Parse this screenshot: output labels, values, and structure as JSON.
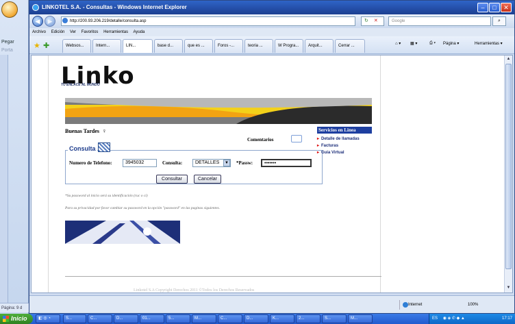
{
  "background_app": {
    "tabs": [
      "Pegar",
      "Porta"
    ],
    "status": "Página: 9 d"
  },
  "window": {
    "title": "LINKOTEL S.A. - Consultas - Windows Internet Explorer",
    "address": "http://200.93.206.219/detalle/consulta.asp",
    "search_placeholder": "Google",
    "menu": [
      "Archivo",
      "Edición",
      "Ver",
      "Favoritos",
      "Herramientas",
      "Ayuda"
    ],
    "tabs": [
      "Websos...",
      "Intern...",
      "LIN...",
      "base d...",
      "que es ...",
      "Foros -...",
      "teoria ...",
      "W Progra...",
      "Arquit...",
      "Cerrar ..."
    ],
    "commands": [
      "Página ▾",
      "Herramientas ▾"
    ],
    "status_zone": "Internet",
    "zoom": "100%"
  },
  "page": {
    "logo_text": "Linko",
    "tagline": "TU ENLACE AL MUNDO",
    "greeting": "Buenas Tardes",
    "comentarios": "Comentarios",
    "consulta": {
      "legend": "Consulta",
      "phone_label": "Numero de Telefono:",
      "phone_value": "3945032",
      "consulta_label": "Consulta:",
      "consulta_value": "DETALLES",
      "pass_label": "*Passw:",
      "pass_value": "•••••••",
      "submit": "Consultar",
      "cancel": "Cancelar"
    },
    "note1": "*Su password al inicio será su identificación (ruc o ci)",
    "note2": "Para su privacidad por favor cambiar su password en la opción \"password\" en las paginas siguientes.",
    "footer": "Linkotel S.A Copyright Derechos 2011 ©Todos los Derechos Reservados",
    "side_menu": {
      "title": "Servicios en Linea",
      "items": [
        "Detalle de llamadas",
        "Facturas",
        "Guia Virtual"
      ]
    }
  },
  "taskbar": {
    "start": "Inicio",
    "tasks": [
      "S...",
      "C...",
      "D...",
      "01...",
      "5...",
      "M...",
      "C...",
      "D...",
      "K...",
      "2...",
      "S...",
      "M..."
    ],
    "lang": "ES",
    "clock": "17:17"
  },
  "colors": {
    "title_blue": "#1c3f91",
    "side_title": "#1e3fa0",
    "accent_red": "#d11111",
    "banner_yellow": "#f3d11a"
  }
}
